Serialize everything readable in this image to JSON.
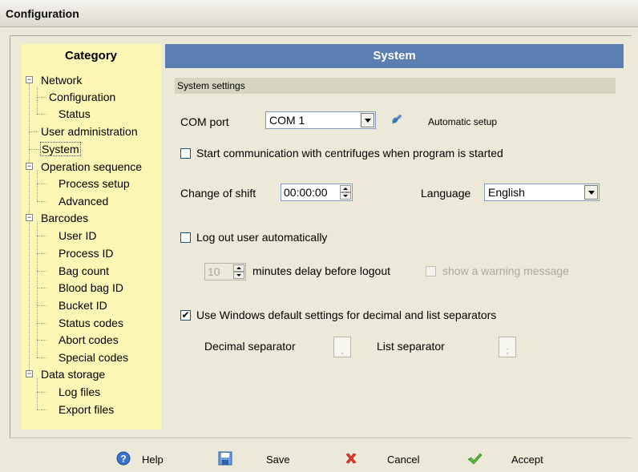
{
  "window": {
    "title": "Configuration"
  },
  "category": {
    "header": "Category",
    "items": [
      {
        "label": "Network"
      },
      {
        "label": "Configuration"
      },
      {
        "label": "Status"
      },
      {
        "label": "User administration"
      },
      {
        "label": "System"
      },
      {
        "label": "Operation sequence"
      },
      {
        "label": "Process setup"
      },
      {
        "label": "Advanced"
      },
      {
        "label": "Barcodes"
      },
      {
        "label": "User ID"
      },
      {
        "label": "Process ID"
      },
      {
        "label": "Bag count"
      },
      {
        "label": "Blood bag ID"
      },
      {
        "label": "Bucket ID"
      },
      {
        "label": "Status codes"
      },
      {
        "label": "Abort codes"
      },
      {
        "label": "Special codes"
      },
      {
        "label": "Data storage"
      },
      {
        "label": "Log files"
      },
      {
        "label": "Export files"
      }
    ],
    "selected": "System"
  },
  "system": {
    "header": "System",
    "section_title": "System settings",
    "com_port_label": "COM port",
    "com_port_value": "COM 1",
    "automatic_setup_label": "Automatic setup",
    "start_comm_label": "Start communication with centrifuges when program is started",
    "start_comm_checked": false,
    "change_shift_label": "Change of shift",
    "change_shift_value": "00:00:00",
    "language_label": "Language",
    "language_value": "English",
    "logout_label": "Log out user automatically",
    "logout_checked": false,
    "minutes_value": "10",
    "minutes_label": "minutes delay before logout",
    "warning_label": "show a warning message",
    "use_windows_label": "Use Windows default settings for decimal and list separators",
    "use_windows_checked": true,
    "use_windows_mark": "✔",
    "decimal_label": "Decimal separator",
    "decimal_value": ",",
    "list_label": "List separator",
    "list_value": ";"
  },
  "footer": {
    "help": "Help",
    "save": "Save",
    "cancel": "Cancel",
    "accept": "Accept"
  },
  "colors": {
    "category_bg": "#fdf7b6",
    "header_blue": "#5a7fb0",
    "section_bar": "#d6d5c0"
  },
  "icons": [
    "help-icon",
    "save-icon",
    "cancel-icon",
    "accept-icon",
    "auto-setup-icon"
  ]
}
